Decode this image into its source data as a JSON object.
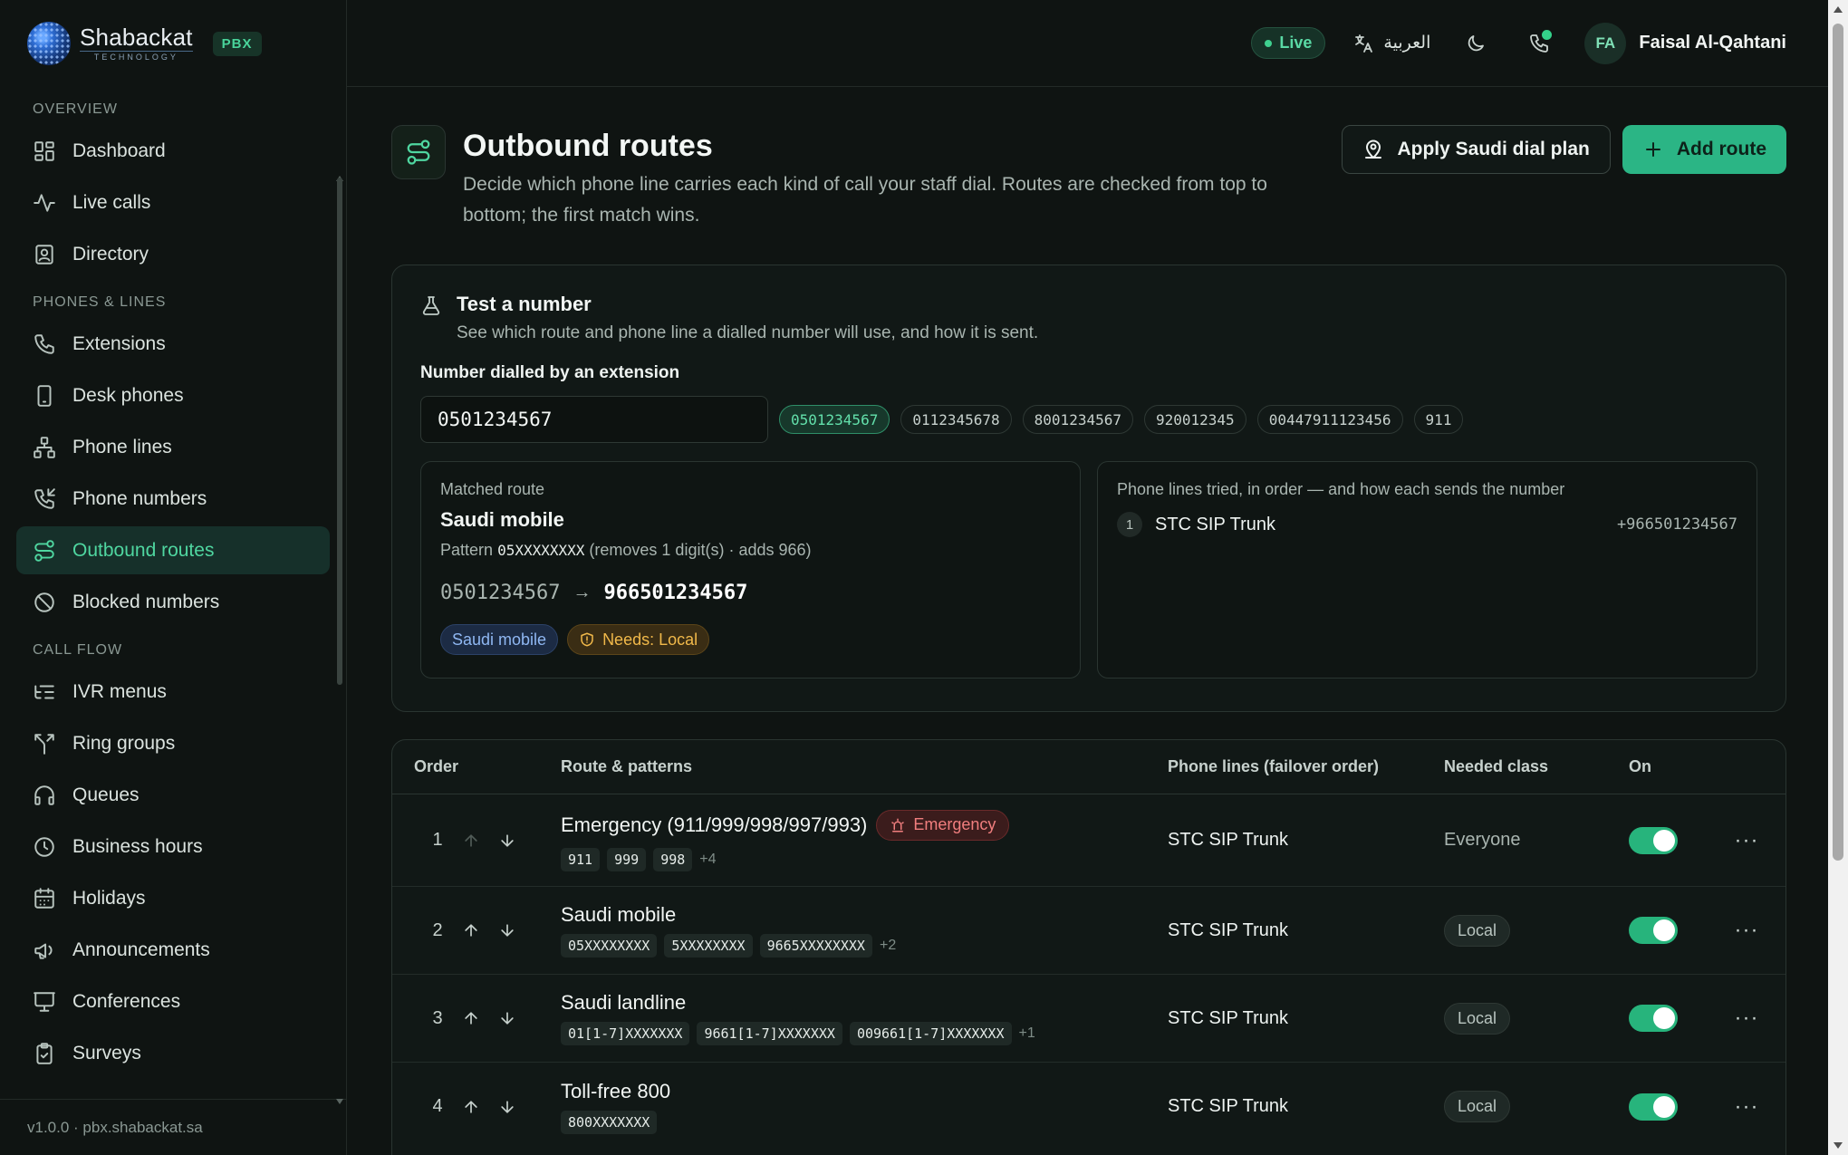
{
  "brand": {
    "name": "Shabackat",
    "sub": "TECHNOLOGY",
    "badge": "PBX"
  },
  "sidebar": {
    "sections": [
      {
        "title": "OVERVIEW",
        "items": [
          {
            "label": "Dashboard",
            "icon": "grid-icon"
          },
          {
            "label": "Live calls",
            "icon": "activity-icon"
          },
          {
            "label": "Directory",
            "icon": "contact-book-icon"
          }
        ]
      },
      {
        "title": "PHONES & LINES",
        "items": [
          {
            "label": "Extensions",
            "icon": "phone-icon"
          },
          {
            "label": "Desk phones",
            "icon": "device-icon"
          },
          {
            "label": "Phone lines",
            "icon": "network-icon"
          },
          {
            "label": "Phone numbers",
            "icon": "phone-incoming-icon"
          },
          {
            "label": "Outbound routes",
            "icon": "route-icon",
            "active": true
          },
          {
            "label": "Blocked numbers",
            "icon": "ban-icon"
          }
        ]
      },
      {
        "title": "CALL FLOW",
        "items": [
          {
            "label": "IVR menus",
            "icon": "list-tree-icon"
          },
          {
            "label": "Ring groups",
            "icon": "split-icon"
          },
          {
            "label": "Queues",
            "icon": "headphones-icon"
          },
          {
            "label": "Business hours",
            "icon": "clock-icon"
          },
          {
            "label": "Holidays",
            "icon": "calendar-icon"
          },
          {
            "label": "Announcements",
            "icon": "megaphone-icon"
          },
          {
            "label": "Conferences",
            "icon": "presentation-icon"
          },
          {
            "label": "Surveys",
            "icon": "clipboard-check-icon"
          }
        ]
      }
    ],
    "footer": "v1.0.0 · pbx.shabackat.sa"
  },
  "topbar": {
    "live": "Live",
    "language": "العربية",
    "avatar_initials": "FA",
    "user_name": "Faisal Al-Qahtani"
  },
  "page": {
    "title": "Outbound routes",
    "description": "Decide which phone line carries each kind of call your staff dial. Routes are checked from top to bottom; the first match wins.",
    "apply_button": "Apply Saudi dial plan",
    "add_button": "Add route"
  },
  "test": {
    "title": "Test a number",
    "subtitle": "See which route and phone line a dialled number will use, and how it is sent.",
    "field_label": "Number dialled by an extension",
    "input_value": "0501234567",
    "samples": [
      "0501234567",
      "0112345678",
      "8001234567",
      "920012345",
      "00447911123456",
      "911"
    ],
    "matched_label": "Matched route",
    "matched_route": "Saudi mobile",
    "pattern_prefix": "Pattern",
    "pattern": "05XXXXXXXX",
    "pattern_suffix": "(removes 1 digit(s) · adds 966)",
    "from_number": "0501234567",
    "to_number": "966501234567",
    "tag_route": "Saudi mobile",
    "tag_needs": "Needs: Local",
    "lines_label": "Phone lines tried, in order — and how each sends the number",
    "lines": [
      {
        "step": "1",
        "name": "STC SIP Trunk",
        "sent_as": "+966501234567"
      }
    ]
  },
  "table": {
    "headers": {
      "order": "Order",
      "route": "Route & patterns",
      "lines": "Phone lines (failover order)",
      "class": "Needed class",
      "on": "On"
    },
    "rows": [
      {
        "order": "1",
        "name": "Emergency (911/999/998/997/993)",
        "badge": "Emergency",
        "patterns": [
          "911",
          "999",
          "998"
        ],
        "more": "+4",
        "line": "STC SIP Trunk",
        "class": "Everyone",
        "class_pill": false
      },
      {
        "order": "2",
        "name": "Saudi mobile",
        "badge": "",
        "patterns": [
          "05XXXXXXXX",
          "5XXXXXXXX",
          "9665XXXXXXXX"
        ],
        "more": "+2",
        "line": "STC SIP Trunk",
        "class": "Local",
        "class_pill": true
      },
      {
        "order": "3",
        "name": "Saudi landline",
        "badge": "",
        "patterns": [
          "01[1-7]XXXXXXX",
          "9661[1-7]XXXXXXX",
          "009661[1-7]XXXXXXX"
        ],
        "more": "+1",
        "line": "STC SIP Trunk",
        "class": "Local",
        "class_pill": true
      },
      {
        "order": "4",
        "name": "Toll-free 800",
        "badge": "",
        "patterns": [
          "800XXXXXXX"
        ],
        "more": "",
        "line": "STC SIP Trunk",
        "class": "Local",
        "class_pill": true
      }
    ]
  },
  "colors": {
    "accent": "#2bb585",
    "background": "#0f1412",
    "emergency": "#f07e7e",
    "warning": "#f1b94a"
  }
}
